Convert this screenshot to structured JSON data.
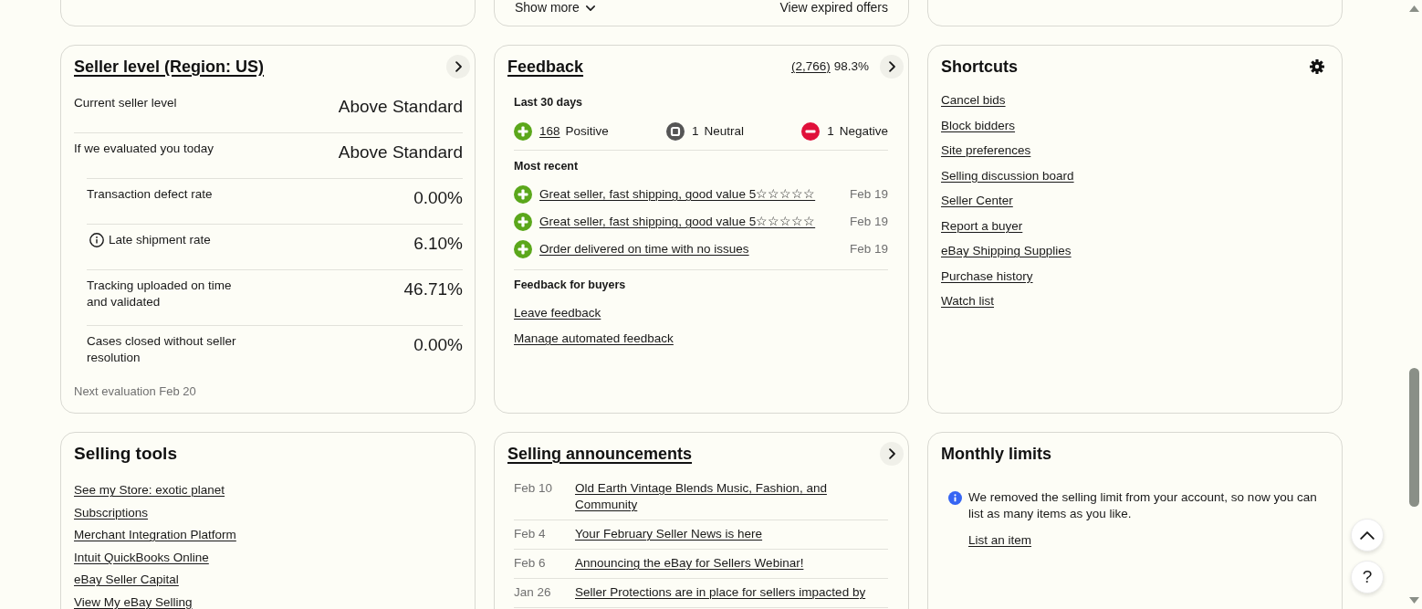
{
  "top_row": [
    {
      "kind": "empty"
    },
    {
      "kind": "offers",
      "show_more": "Show more",
      "view_link": "View expired offers"
    },
    {
      "kind": "empty"
    }
  ],
  "cards": [
    {
      "kind": "seller_level",
      "title": "Seller level (Region: US)",
      "title_link": true,
      "chevron_button": true,
      "settings_button": false,
      "rows": [
        {
          "label": "Current seller level",
          "value": "Above Standard",
          "info": false
        },
        {
          "label": "If we evaluated you today",
          "value": "Above Standard",
          "info": false,
          "children": [
            {
              "label": "Transaction defect rate",
              "value": "0.00%",
              "info": false
            },
            {
              "label": "Late shipment rate",
              "value": "6.10%",
              "info": true
            },
            {
              "label": "Tracking uploaded on time and validated",
              "value": "46.71%",
              "info": false
            },
            {
              "label": "Cases closed without seller resolution",
              "value": "0.00%",
              "info": false
            }
          ]
        }
      ],
      "footnote": "Next evaluation Feb 20"
    },
    {
      "kind": "feedback",
      "title": "Feedback",
      "title_link": true,
      "chevron_button": true,
      "settings_button": false,
      "score_count": "(2,766)",
      "score_percent": "98.3%",
      "period": "Last 30 days",
      "counts": [
        {
          "kind": "positive",
          "count": "168",
          "label": "Positive",
          "linked": true
        },
        {
          "kind": "neutral",
          "count": "1",
          "label": "Neutral",
          "linked": false
        },
        {
          "kind": "negative",
          "count": "1",
          "label": "Negative",
          "linked": false
        }
      ],
      "recent_title": "Most recent",
      "recent": [
        {
          "kind": "positive",
          "text": "Great seller, fast shipping, good value 5☆☆☆☆☆",
          "date": "Feb 19"
        },
        {
          "kind": "positive",
          "text": "Great seller, fast shipping, good value 5☆☆☆☆☆",
          "date": "Feb 19"
        },
        {
          "kind": "positive",
          "text": "Order delivered on time with no issues",
          "date": "Feb 19"
        }
      ],
      "buyers_title": "Feedback for buyers",
      "buyer_links": [
        "Leave feedback",
        "Manage automated feedback"
      ]
    },
    {
      "kind": "shortcuts",
      "title": "Shortcuts",
      "title_link": false,
      "chevron_button": false,
      "settings_button": true,
      "links": [
        "Cancel bids",
        "Block bidders",
        "Site preferences",
        "Selling discussion board",
        "Seller Center",
        "Report a buyer",
        "eBay Shipping Supplies",
        "Purchase history",
        "Watch list"
      ]
    },
    {
      "kind": "tools",
      "title": "Selling tools",
      "title_link": false,
      "chevron_button": false,
      "settings_button": false,
      "links": [
        "See my Store: exotic planet",
        "Subscriptions",
        "Merchant Integration Platform",
        "Intuit QuickBooks Online",
        "eBay Seller Capital",
        "View My eBay Selling"
      ]
    },
    {
      "kind": "announcements",
      "title": "Selling announcements",
      "title_link": true,
      "chevron_button": true,
      "settings_button": false,
      "items": [
        {
          "date": "Feb 10",
          "text": "Old Earth Vintage Blends Music, Fashion, and Community"
        },
        {
          "date": "Feb 4",
          "text": "Your February Seller News is here"
        },
        {
          "date": "Feb 6",
          "text": "Announcing the eBay for Sellers Webinar!"
        },
        {
          "date": "Jan 26",
          "text": "Seller Protections are in place for sellers impacted by"
        }
      ]
    },
    {
      "kind": "limits",
      "title": "Monthly limits",
      "title_link": false,
      "chevron_button": false,
      "settings_button": false,
      "message": "We removed the selling limit from your account, so now you can list as many items as you like.",
      "link": "List an item"
    }
  ],
  "floating_buttons": {
    "help": "?"
  }
}
